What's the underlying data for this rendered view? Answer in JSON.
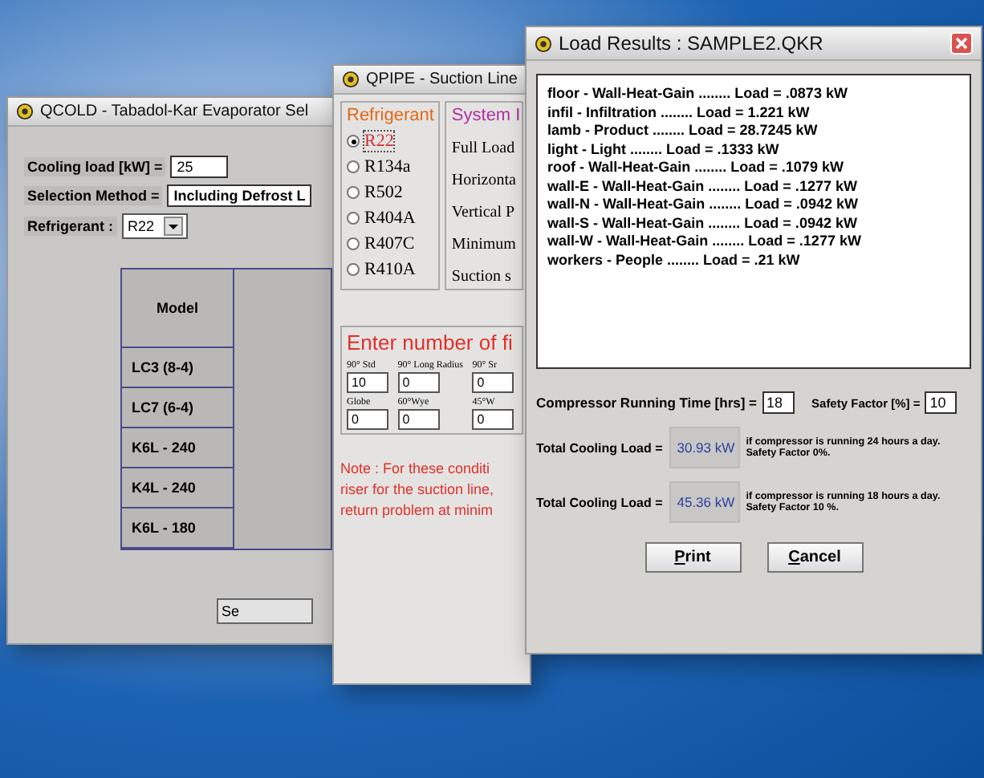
{
  "qcold": {
    "title": "QCOLD - Tabadol-Kar  Evaporator Sel",
    "cooling_load": {
      "label": "Cooling load [kW] =",
      "value": "25"
    },
    "selection_method": {
      "label": "Selection Method =",
      "value": "Including Defrost L"
    },
    "refrigerant": {
      "label": "Refrigerant :",
      "value": "R22"
    },
    "table": {
      "columns": [
        "Model"
      ],
      "rows": [
        "LC3 (8-4)",
        "LC7  (6-4)",
        "K6L - 240",
        "K4L - 240",
        "K6L - 180"
      ]
    },
    "button": "Se"
  },
  "qpipe": {
    "title": "QPIPE - Suction Line",
    "refrigerant_group": "Refrigerant",
    "refrigerants": [
      {
        "label": "R22",
        "selected": true
      },
      {
        "label": "R134a",
        "selected": false
      },
      {
        "label": "R502",
        "selected": false
      },
      {
        "label": "R404A",
        "selected": false
      },
      {
        "label": "R407C",
        "selected": false
      },
      {
        "label": "R410A",
        "selected": false
      }
    ],
    "system_group": "System I",
    "system_labels": [
      "Full Load",
      "Horizonta",
      "Vertical P",
      "Minimum",
      "Suction s"
    ],
    "fittings_group": "Enter number of fi",
    "fittings": [
      {
        "label": "90° Std",
        "value": "10"
      },
      {
        "label": "90° Long Radius",
        "value": "0"
      },
      {
        "label": "90° Sr",
        "value": "0"
      },
      {
        "label": "Globe",
        "value": "0"
      },
      {
        "label": "60°Wye",
        "value": "0"
      },
      {
        "label": "45°W",
        "value": "0"
      }
    ],
    "note": [
      "Note : For these conditi",
      "riser for the suction line,",
      "return problem at minim"
    ]
  },
  "results": {
    "title": "Load Results : SAMPLE2.QKR",
    "lines": [
      "floor  -  Wall-Heat-Gain ........ Load =  .0873  kW",
      "infil  -  Infiltration ........ Load =  1.221  kW",
      "lamb  -  Product ........ Load =  28.7245  kW",
      "light  -  Light ........ Load =  .1333  kW",
      "roof  -  Wall-Heat-Gain ........ Load =  .1079  kW",
      "wall-E  -  Wall-Heat-Gain ........ Load =  .1277  kW",
      "wall-N  -  Wall-Heat-Gain ........ Load =  .0942  kW",
      "wall-S  -  Wall-Heat-Gain ........ Load =  .0942  kW",
      "wall-W  -  Wall-Heat-Gain ........ Load =  .1277  kW",
      "workers  -  People ........ Load =  .21  kW"
    ],
    "running_time": {
      "label": "Compressor Running Time [hrs] =",
      "value": "18"
    },
    "safety_factor": {
      "label": "Safety Factor [%] =",
      "value": "10"
    },
    "totals": [
      {
        "label": "Total Cooling Load =",
        "value": "30.93 kW",
        "note": [
          "if compressor is running 24 hours a day.",
          "Safety Factor 0%."
        ]
      },
      {
        "label": "Total Cooling Load =",
        "value": "45.36 kW",
        "note": [
          "if compressor is running 18 hours a day.",
          "Safety Factor 10 %."
        ]
      }
    ],
    "buttons": [
      "Print",
      "Cancel"
    ]
  }
}
